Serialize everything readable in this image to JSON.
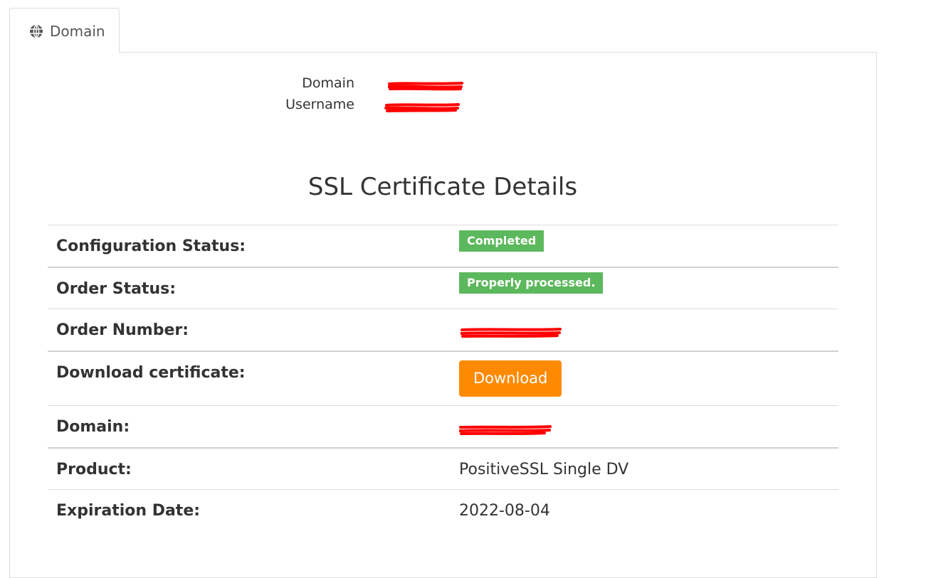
{
  "tab": {
    "label": "Domain",
    "icon": "globe-icon"
  },
  "account": {
    "domain_label": "Domain",
    "username_label": "Username"
  },
  "heading": "SSL Certificate Details",
  "details": {
    "config_status_label": "Configuration Status:",
    "config_status_value": "Completed",
    "order_status_label": "Order Status:",
    "order_status_value": "Properly processed.",
    "order_number_label": "Order Number:",
    "download_label": "Download certificate:",
    "download_button": "Download",
    "domain_label": "Domain:",
    "product_label": "Product:",
    "product_value": "PositiveSSL Single DV",
    "expiration_label": "Expiration Date:",
    "expiration_value": "2022-08-04"
  },
  "colors": {
    "badge_green": "#5cb85c",
    "download_orange": "#ff8a00",
    "redaction_red": "#ff0000"
  }
}
